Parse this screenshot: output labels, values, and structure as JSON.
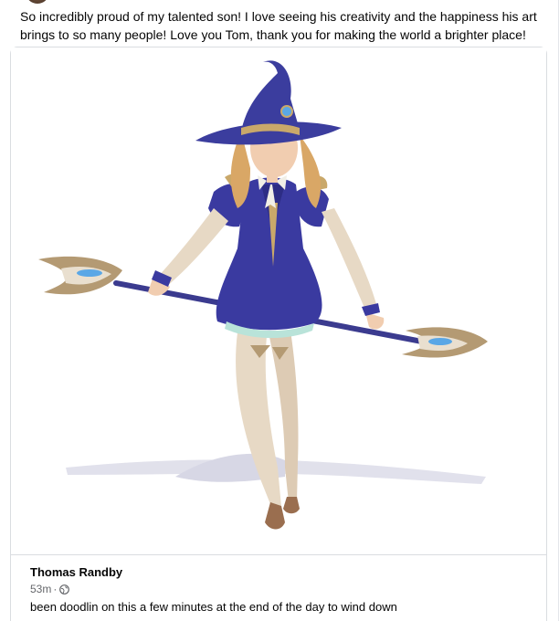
{
  "post": {
    "caption": "So incredibly proud of my talented son! I love seeing his creativity and the happiness his art brings to so many people! Love you Tom, thank you for making the world a brighter place!"
  },
  "shared_post": {
    "author": "Thomas Randby",
    "time": "53m",
    "separator": "·",
    "privacy_icon": "globe-icon",
    "text": "been doodlin on this a few minutes at the end of the day to wind down"
  },
  "colors": {
    "hat": "#3b3d9e",
    "dress": "#3a3aa0",
    "skin": "#f1cdb0",
    "hair": "#d9a766",
    "stockings": "#e7d9c5",
    "staff_gold": "#b49a73",
    "staff_blue": "#5aa7e6"
  }
}
